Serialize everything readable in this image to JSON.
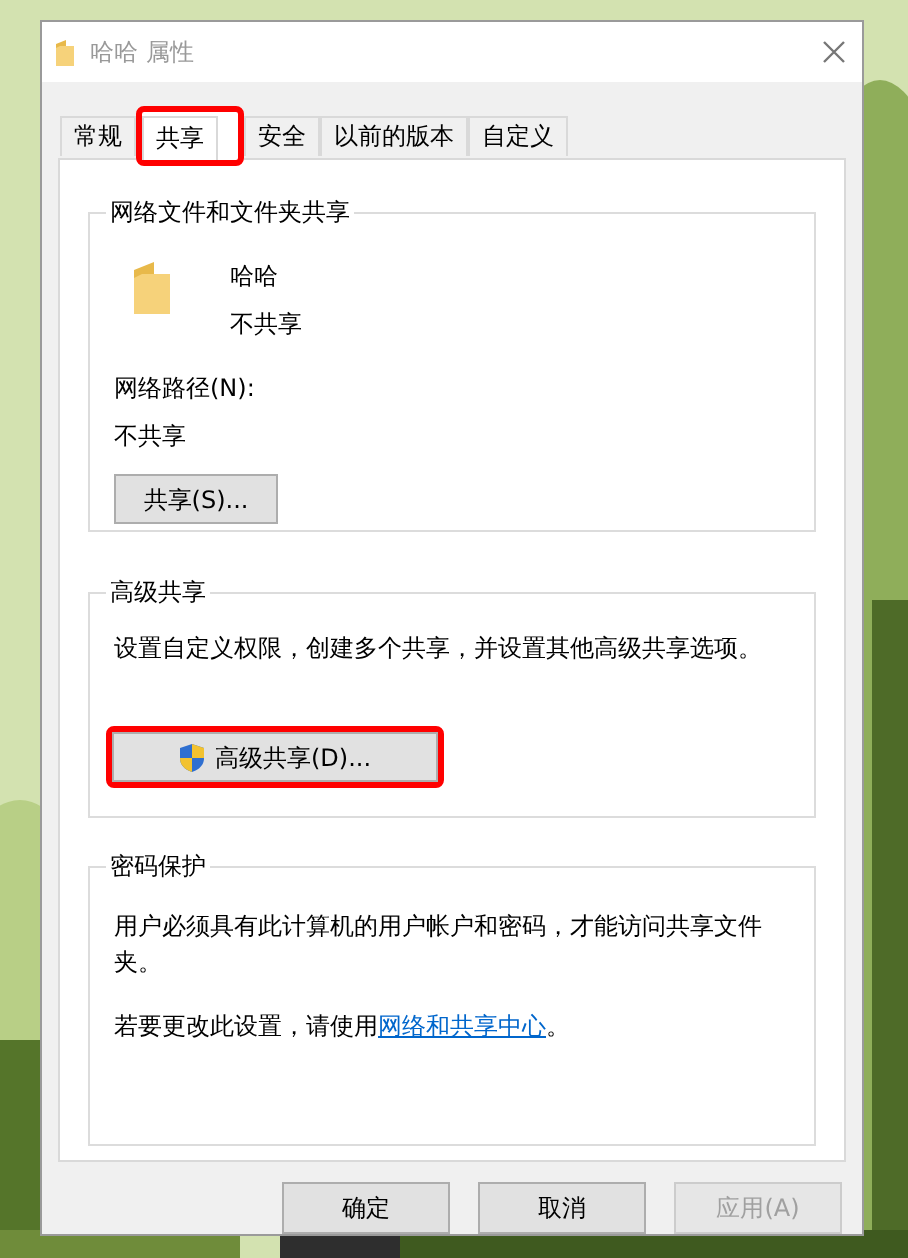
{
  "window": {
    "title": "哈哈 属性"
  },
  "tabs": [
    {
      "label": "常规",
      "selected": false,
      "highlighted": false
    },
    {
      "label": "共享",
      "selected": true,
      "highlighted": true
    },
    {
      "label": "安全",
      "selected": false,
      "highlighted": false
    },
    {
      "label": "以前的版本",
      "selected": false,
      "highlighted": false
    },
    {
      "label": "自定义",
      "selected": false,
      "highlighted": false
    }
  ],
  "sections": [
    {
      "kind": "share",
      "title": "网络文件和文件夹共享",
      "folder_name": "哈哈",
      "status": "不共享",
      "path_label": "网络路径(N):",
      "path_value": "不共享",
      "button": {
        "label": "共享(S)...",
        "highlighted": false
      }
    },
    {
      "kind": "advanced",
      "title": "高级共享",
      "description": "设置自定义权限，创建多个共享，并设置其他高级共享选项。",
      "button": {
        "label": "高级共享(D)...",
        "highlighted": true
      }
    },
    {
      "kind": "password",
      "title": "密码保护",
      "description": "用户必须具有此计算机的用户帐户和密码，才能访问共享文件夹。",
      "note": "若要更改此设置，请使用",
      "link": "网络和共享中心",
      "note_end": "。"
    }
  ],
  "buttons": [
    {
      "label": "确定",
      "disabled": false
    },
    {
      "label": "取消",
      "disabled": false
    },
    {
      "label": "应用(A)",
      "disabled": true
    }
  ]
}
